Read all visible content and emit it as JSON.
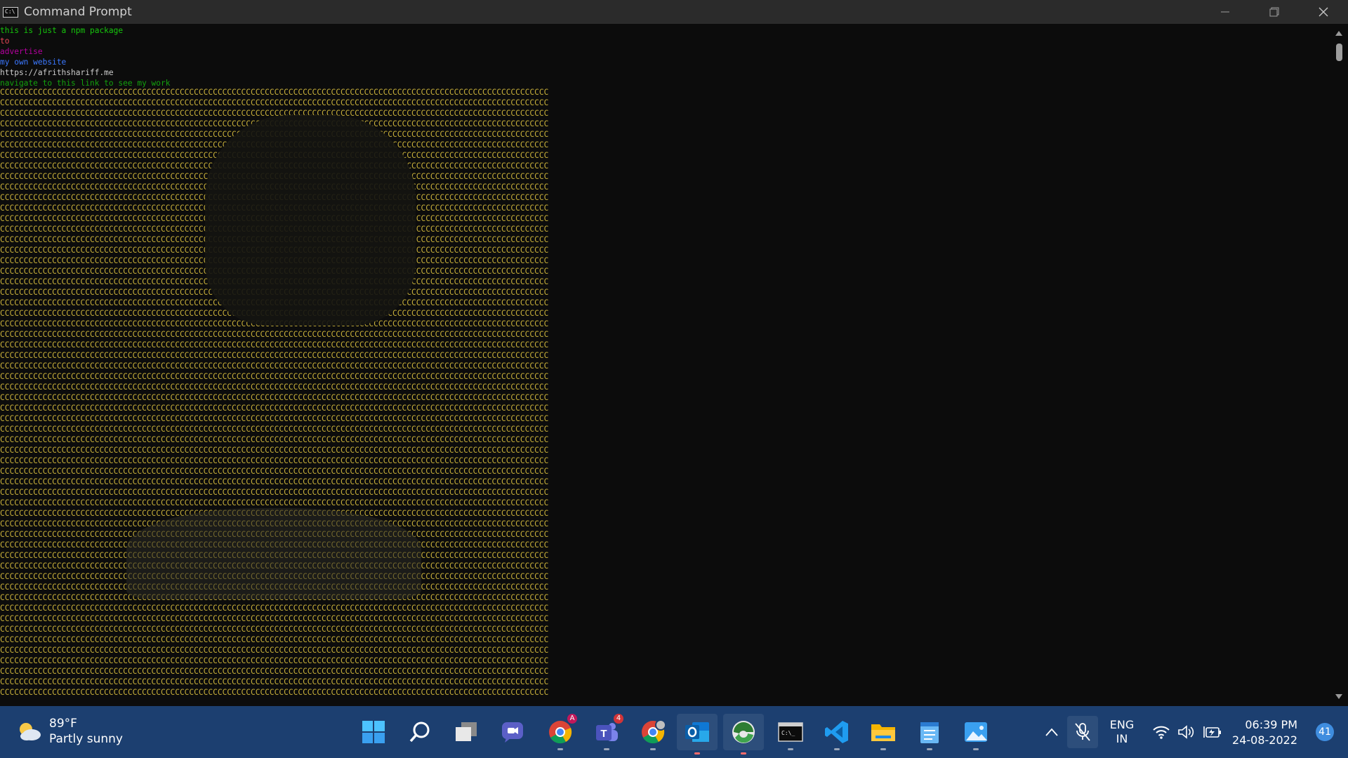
{
  "window": {
    "title": "Command Prompt"
  },
  "console": {
    "messages": [
      {
        "text": "this is just a npm package",
        "color": "#16c60c"
      },
      {
        "text": "to",
        "color": "#e74856"
      },
      {
        "text": "advertise",
        "color": "#b4009e"
      },
      {
        "text": "my own website",
        "color": "#3b78ff"
      },
      {
        "text": "https://afrithshariff.me",
        "color": "#cccccc"
      },
      {
        "text": "navigate to this link to see my work",
        "color": "#13a10e"
      }
    ],
    "ascii_art_line": "CCCCCCCCCCCCCCCCCCCCCCCCCCCCCCCCCCCCCCCCCCCCCCCCCCCCCCCCCCCCCCCCCCCCCCCCCCCCCCCCCCCCCCCCCCCCCCCCCCCCCCCCCCCCCCCCCCCC",
    "ascii_art_color": "#c8b03a"
  },
  "taskbar": {
    "weather": {
      "temp": "89°F",
      "description": "Partly sunny",
      "icon": "partly-sunny-icon"
    },
    "apps": [
      {
        "name": "start-button",
        "icon": "windows-logo-icon"
      },
      {
        "name": "search-button",
        "icon": "search-icon"
      },
      {
        "name": "task-view-button",
        "icon": "task-view-icon"
      },
      {
        "name": "chat-button",
        "icon": "chat-icon"
      },
      {
        "name": "chrome-profile-a",
        "icon": "chrome-icon"
      },
      {
        "name": "teams-button",
        "icon": "teams-icon",
        "badge": "4"
      },
      {
        "name": "chrome-profile-b",
        "icon": "chrome-icon"
      },
      {
        "name": "outlook-button",
        "icon": "outlook-icon"
      },
      {
        "name": "browser-button",
        "icon": "browser-icon"
      },
      {
        "name": "terminal-button",
        "icon": "terminal-icon"
      },
      {
        "name": "vscode-button",
        "icon": "vscode-icon"
      },
      {
        "name": "file-explorer-button",
        "icon": "folder-icon"
      },
      {
        "name": "notepad-button",
        "icon": "notepad-icon"
      },
      {
        "name": "photos-button",
        "icon": "photos-icon"
      }
    ],
    "tray": {
      "language": "ENG",
      "region": "IN",
      "time": "06:39 PM",
      "date": "24-08-2022",
      "notifications": "41"
    }
  }
}
